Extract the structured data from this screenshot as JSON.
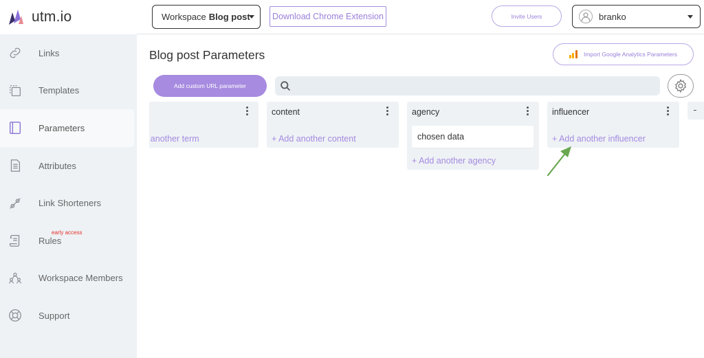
{
  "brand": {
    "name": "utm.io"
  },
  "sidebar": {
    "items": [
      {
        "label": "Links",
        "icon": "link-icon"
      },
      {
        "label": "Templates",
        "icon": "templates-icon"
      },
      {
        "label": "Parameters",
        "icon": "parameters-icon",
        "active": true
      },
      {
        "label": "Attributes",
        "icon": "document-icon"
      },
      {
        "label": "Link Shorteners",
        "icon": "shortener-icon"
      },
      {
        "label": "Rules",
        "icon": "scroll-icon",
        "badge": "early access"
      },
      {
        "label": "Workspace Members",
        "icon": "members-icon"
      },
      {
        "label": "Support",
        "icon": "lifebuoy-icon"
      }
    ]
  },
  "topbar": {
    "workspace_prefix": "Workspace",
    "workspace_name": "Blog post",
    "chrome_extension_label": "Download Chrome Extension",
    "invite_label": "Invite Users",
    "user_name": "branko"
  },
  "main": {
    "title": "Blog post Parameters",
    "import_ga_label": "Import Google Analytics Parameters",
    "add_param_label": "Add custom URL parameter",
    "search": {
      "value": "",
      "placeholder": ""
    }
  },
  "board": {
    "columns": [
      {
        "title": "",
        "cards": [],
        "add_label": "+ Add another term"
      },
      {
        "title": "content",
        "cards": [],
        "add_label": "+ Add another content"
      },
      {
        "title": "agency",
        "cards": [
          "chosen data"
        ],
        "add_label": "+ Add another agency"
      },
      {
        "title": "influencer",
        "cards": [],
        "add_label": "+ Add another influencer"
      }
    ]
  },
  "colors": {
    "accent": "#a78be0",
    "sidebar_bg": "#eef2f5",
    "badge_red": "#e5322b",
    "arrow_green": "#6aa84f"
  }
}
